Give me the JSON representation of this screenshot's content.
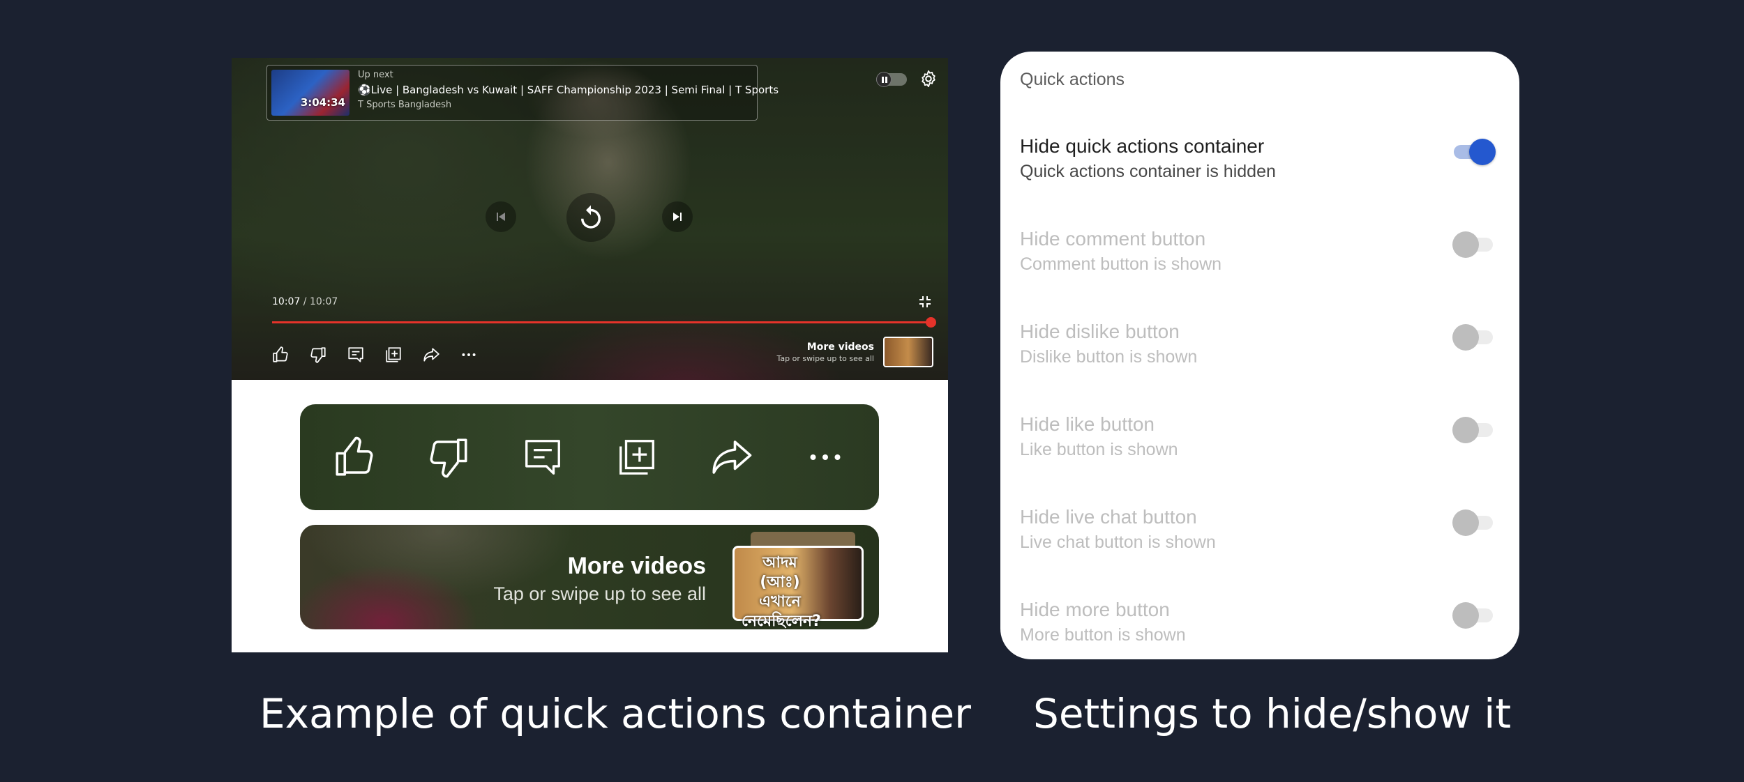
{
  "player": {
    "up_next_label": "Up next",
    "up_next_title": "⚽Live | Bangladesh vs Kuwait | SAFF Championship 2023 | Semi Final | T Sports",
    "up_next_channel": "T Sports Bangladesh",
    "up_next_duration": "3:04:34",
    "current_time": "10:07",
    "time_separator": " / ",
    "total_time": "10:07",
    "progress": 1.0,
    "progress_color": "#e5332a",
    "more_videos_title": "More videos",
    "more_videos_subtitle": "Tap or swipe up to see all"
  },
  "quick_actions": {
    "icons": [
      "like-icon",
      "dislike-icon",
      "comment-icon",
      "save-to-playlist-icon",
      "share-icon",
      "more-icon"
    ]
  },
  "more_card": {
    "title": "More videos",
    "subtitle": "Tap or swipe up to see all",
    "thumb_text": "আদম (আঃ) এখানে নেমেছিলেন?"
  },
  "captions": {
    "left": "Example of quick actions container",
    "right": "Settings to hide/show it"
  },
  "settings": {
    "header": "Quick actions",
    "accent_color": "#2458cf",
    "items": [
      {
        "title": "Hide quick actions container",
        "subtitle": "Quick actions container is hidden",
        "enabled": true,
        "checked": true
      },
      {
        "title": "Hide comment button",
        "subtitle": "Comment button is shown",
        "enabled": false,
        "checked": false
      },
      {
        "title": "Hide dislike button",
        "subtitle": "Dislike button is shown",
        "enabled": false,
        "checked": false
      },
      {
        "title": "Hide like button",
        "subtitle": "Like button is shown",
        "enabled": false,
        "checked": false
      },
      {
        "title": "Hide live chat button",
        "subtitle": "Live chat button is shown",
        "enabled": false,
        "checked": false
      },
      {
        "title": "Hide more button",
        "subtitle": "More button is shown",
        "enabled": false,
        "checked": false
      }
    ]
  }
}
